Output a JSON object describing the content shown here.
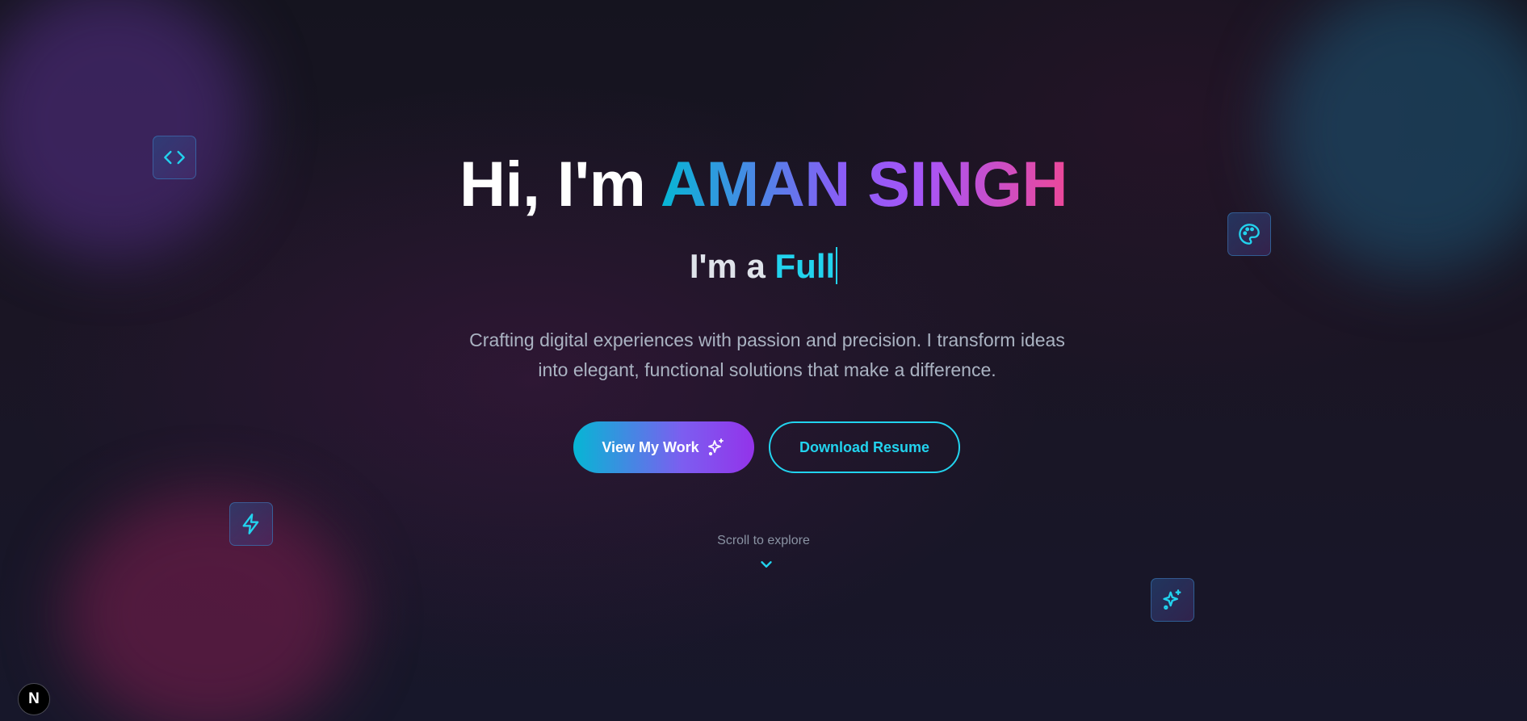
{
  "hero": {
    "greeting": "Hi, I'm ",
    "name": "AMAN SINGH",
    "typing_prefix": "I'm a ",
    "typing_word": "Full",
    "description": "Crafting digital experiences with passion and precision. I transform ideas into elegant, functional solutions that make a difference."
  },
  "buttons": {
    "primary_label": "View My Work",
    "secondary_label": "Download Resume"
  },
  "scroll": {
    "label": "Scroll to explore"
  },
  "badge": {
    "label": "N"
  },
  "floating_icons": [
    "code-icon",
    "palette-icon",
    "bolt-icon",
    "sparkles-icon"
  ],
  "colors": {
    "accent_cyan": "#22d3ee",
    "accent_purple": "#a855f7",
    "accent_pink": "#ec4899",
    "background": "#14131f"
  }
}
